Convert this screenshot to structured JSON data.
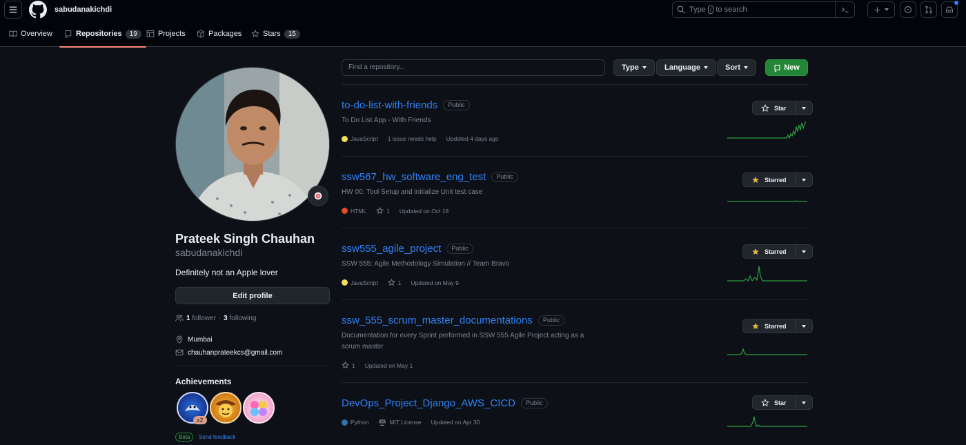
{
  "header": {
    "username": "sabudanakichdi",
    "search_prefix": "Type",
    "search_key": "/",
    "search_suffix": "to search"
  },
  "tabs": [
    {
      "label": "Overview"
    },
    {
      "label": "Repositories",
      "count": "19"
    },
    {
      "label": "Projects"
    },
    {
      "label": "Packages"
    },
    {
      "label": "Stars",
      "count": "15"
    }
  ],
  "profile": {
    "name": "Prateek Singh Chauhan",
    "login": "sabudanakichdi",
    "bio": "Definitely not an Apple lover",
    "edit_label": "Edit profile",
    "followers_count": "1",
    "followers_label": "follower",
    "dot": "·",
    "following_count": "3",
    "following_label": "following",
    "location": "Mumbai",
    "email": "chauhanprateekcs@gmail.com",
    "achievements_title": "Achievements",
    "achievement_multiplier": "x2",
    "beta_label": "Beta",
    "feedback_label": "Send feedback"
  },
  "filters": {
    "search_placeholder": "Find a repository...",
    "type_label": "Type",
    "language_label": "Language",
    "sort_label": "Sort",
    "new_label": "New"
  },
  "repos": [
    {
      "name": "to-do-list-with-friends",
      "visibility": "Public",
      "description": "To Do List App - With Friends",
      "language": "JavaScript",
      "language_color": "#f1e05a",
      "extra": "1 issue needs help",
      "updated": "Updated 4 days ago",
      "star_label": "Star",
      "starred": false
    },
    {
      "name": "ssw567_hw_software_eng_test",
      "visibility": "Public",
      "description": "HW 00: Tool Setup and initialize Unit test case",
      "language": "HTML",
      "language_color": "#e34c26",
      "stars": "1",
      "updated": "Updated on Oct 18",
      "star_label": "Starred",
      "starred": true
    },
    {
      "name": "ssw555_agile_project",
      "visibility": "Public",
      "description": "SSW 555: Agile Methodology Simulation // Team Bravo",
      "language": "JavaScript",
      "language_color": "#f1e05a",
      "stars": "1",
      "updated": "Updated on May 9",
      "star_label": "Starred",
      "starred": true
    },
    {
      "name": "ssw_555_scrum_master_documentations",
      "visibility": "Public",
      "description": "Documentation for every Sprint performed in SSW 555 Agile Project acting as a scrum master",
      "stars": "1",
      "updated": "Updated on May 1",
      "star_label": "Starred",
      "starred": true
    },
    {
      "name": "DevOps_Project_Django_AWS_CICD",
      "visibility": "Public",
      "language": "Python",
      "language_color": "#3572A5",
      "license": "MIT License",
      "updated": "Updated on Apr 30",
      "star_label": "Star",
      "starred": false
    }
  ],
  "colors": {
    "accent": "#2f81f7",
    "new_button": "#238636",
    "spark": "#2ea043",
    "star_fill": "#e3b341",
    "tab_underline": "#fd8c73"
  }
}
